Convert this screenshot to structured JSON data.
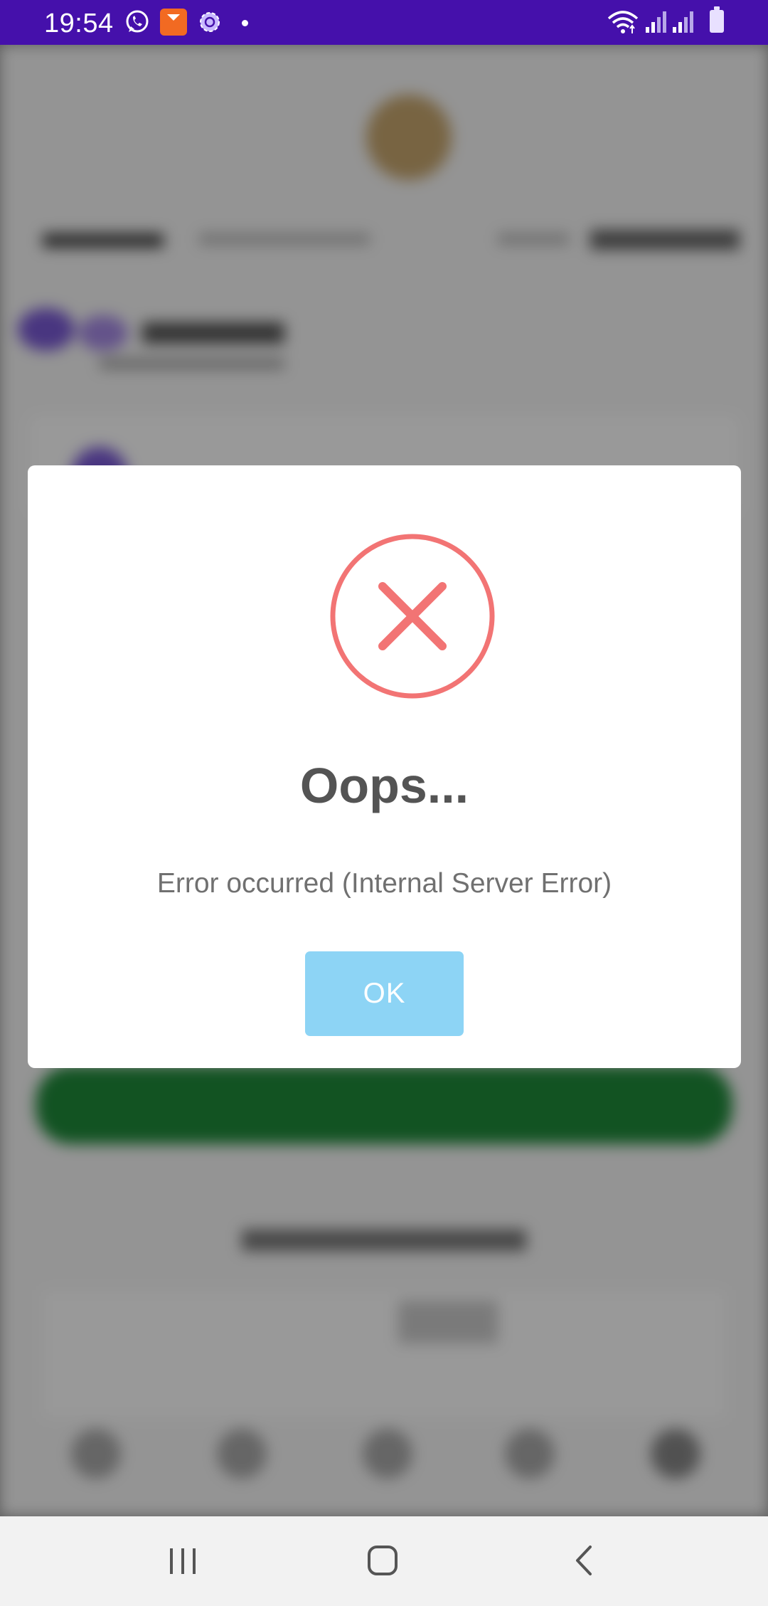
{
  "status_bar": {
    "time": "19:54",
    "notification_icons": [
      "whatsapp-icon",
      "kilimall-app-icon",
      "settings-gear-icon",
      "dot-icon"
    ],
    "system_icons": [
      "wifi-icon",
      "signal-icon",
      "signal-icon",
      "battery-icon"
    ],
    "kilimall_label": "Kilimall",
    "colors": {
      "background": "#4510ab"
    }
  },
  "dialog": {
    "icon": "error-x-icon",
    "title": "Oops...",
    "message": "Error occurred (Internal Server Error)",
    "ok_label": "OK",
    "colors": {
      "icon": "#f27474",
      "ok_button": "#8dd4f5",
      "title": "#545454"
    }
  },
  "nav_bar": {
    "buttons": [
      "recent-apps-icon",
      "home-icon",
      "back-icon"
    ]
  }
}
